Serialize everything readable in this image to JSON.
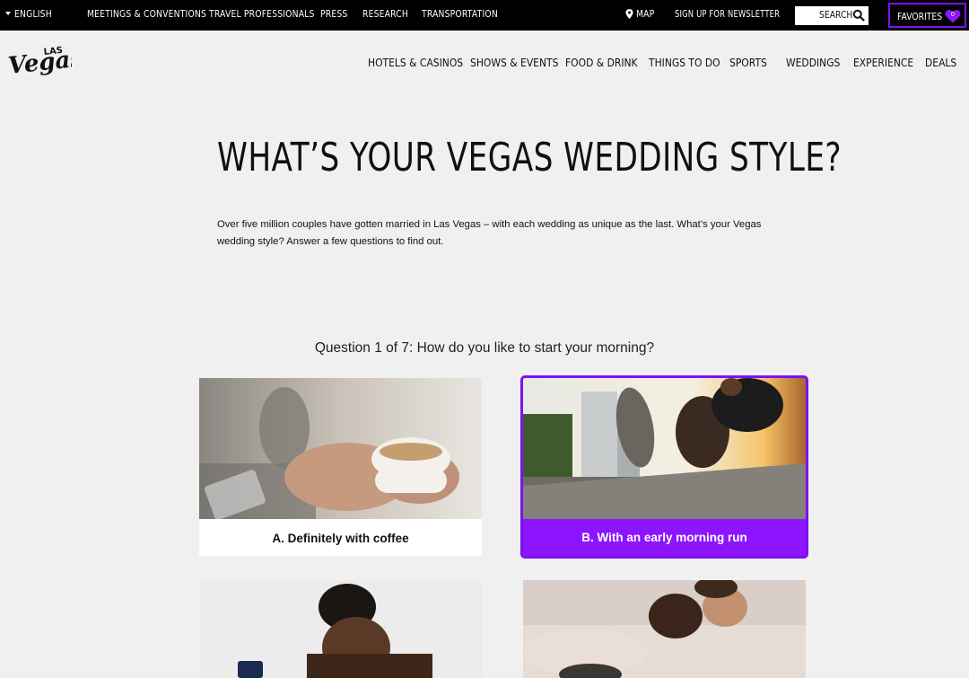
{
  "topbar": {
    "language": "ENGLISH",
    "links": [
      "MEETINGS & CONVENTIONS",
      "TRAVEL PROFESSIONALS",
      "PRESS",
      "RESEARCH",
      "TRANSPORTATION"
    ],
    "map": "MAP",
    "newsletter": "SIGN UP FOR NEWSLETTER",
    "search": "SEARCH",
    "favorites": "FAVORITES",
    "favorites_count": "0"
  },
  "brand": {
    "logo_text_top": "LAS",
    "logo_text_main": "Vegas"
  },
  "nav": {
    "items": [
      "HOTELS & CASINOS",
      "SHOWS & EVENTS",
      "FOOD & DRINK",
      "THINGS TO DO",
      "SPORTS",
      "WEDDINGS",
      "EXPERIENCE",
      "DEALS"
    ]
  },
  "hero": {
    "title": "WHAT’S YOUR VEGAS WEDDING STYLE?",
    "intro": "Over five million couples have gotten married in Las Vegas – with each wedding as unique as the last. What’s your Vegas wedding style? Answer a few questions to find out."
  },
  "quiz": {
    "question": "Question 1 of 7: How do you like to start your morning?",
    "selected_option": "B",
    "options": [
      {
        "label": "A. Definitely with coffee",
        "image": "coffee-cup-photo"
      },
      {
        "label": "B. With an early morning run",
        "image": "runner-stretching-photo"
      },
      {
        "label": "",
        "image": "woman-sleeping-photo"
      },
      {
        "label": "",
        "image": "couple-in-bed-photo"
      }
    ]
  },
  "colors": {
    "accent": "#8c14ff",
    "accent_border": "#7b12f2",
    "topbar_bg": "#000000",
    "page_bg": "#f0f0f0"
  }
}
